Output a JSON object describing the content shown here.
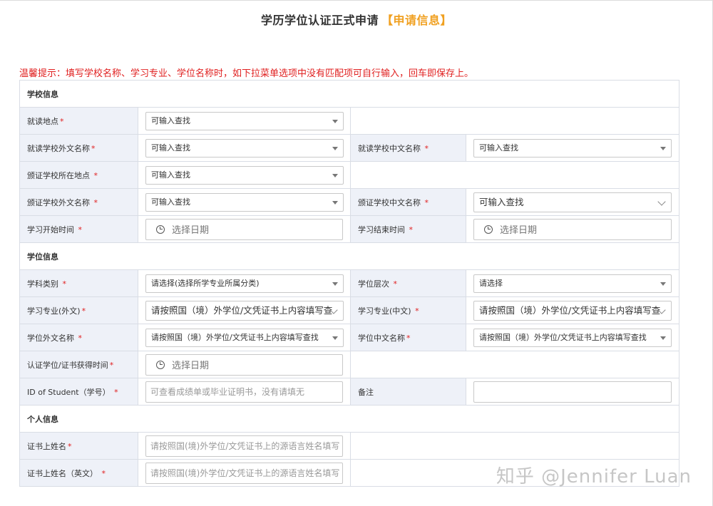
{
  "title": "学历学位认证正式申请",
  "title_tag": "【申请信息】",
  "tip": "温馨提示：填写学校名称、学习专业、学位名称时，如下拉菜单选项中没有匹配项可自行输入，回车即保存上。",
  "required_mark": "*",
  "sections": {
    "school": "学校信息",
    "degree": "学位信息",
    "personal": "个人信息"
  },
  "fields": {
    "study_location": {
      "label": "就读地点",
      "placeholder": "可输入查找"
    },
    "school_foreign_name": {
      "label": "就读学校外文名称",
      "placeholder": "可输入查找"
    },
    "school_chinese_name": {
      "label": "就读学校中文名称 ",
      "placeholder": "可输入查找"
    },
    "issuing_school_location": {
      "label": "颁证学校所在地点 ",
      "placeholder": "可输入查找"
    },
    "issuing_school_foreign_name": {
      "label": "颁证学校外文名称 ",
      "placeholder": "可输入查找"
    },
    "issuing_school_chinese_name": {
      "label": "颁证学校中文名称 ",
      "placeholder": "可输入查找"
    },
    "study_start": {
      "label": "学习开始时间 ",
      "placeholder": "选择日期"
    },
    "study_end": {
      "label": "学习结束时间 ",
      "placeholder": "选择日期"
    },
    "subject_category": {
      "label": "学科类别 ",
      "placeholder": "请选择(选择所学专业所属分类)"
    },
    "degree_level": {
      "label": "学位层次 ",
      "placeholder": "请选择"
    },
    "major_foreign": {
      "label": "学习专业(外文)",
      "placeholder": "请按照国（境）外学位/文凭证书上内容填写查"
    },
    "major_chinese": {
      "label": "学习专业(中文) ",
      "placeholder": "请按照国（境）外学位/文凭证书上内容填写查"
    },
    "degree_foreign_name": {
      "label": "学位外文名称 ",
      "placeholder": "请按照国（境）外学位/文凭证书上内容填写查找"
    },
    "degree_chinese_name": {
      "label": "学位中文名称",
      "placeholder": "请按照国（境）外学位/文凭证书上内容填写查找"
    },
    "certificate_date": {
      "label": "认证学位/证书获得时间",
      "placeholder": "选择日期"
    },
    "student_id": {
      "label": "ID of Student（学号） ",
      "placeholder": "可查看成绩单或毕业证明书，没有请填无"
    },
    "remarks": {
      "label": "备注",
      "value": ""
    },
    "cert_name": {
      "label": "证书上姓名",
      "placeholder": "请按照国(境)外学位/文凭证书上的源语言姓名填写"
    },
    "cert_name_en": {
      "label": "证书上姓名（英文） ",
      "placeholder": "请按照国(境)外学位/文凭证书上的源语言姓名填写"
    }
  },
  "watermark": "知乎 @Jennifer Luan"
}
